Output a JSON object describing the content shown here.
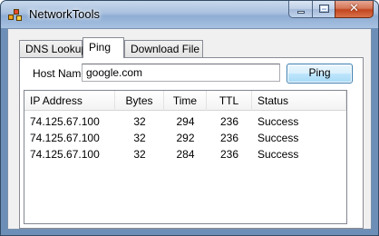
{
  "window": {
    "title": "NetworkTools"
  },
  "tabs": [
    {
      "label": "DNS Lookup",
      "active": false
    },
    {
      "label": "Ping",
      "active": true
    },
    {
      "label": "Download File",
      "active": false
    }
  ],
  "ping": {
    "host_label": "Host Name:",
    "host_value": "google.com",
    "ping_button": "Ping"
  },
  "results": {
    "columns": [
      "IP Address",
      "Bytes",
      "Time",
      "TTL",
      "Status"
    ],
    "rows": [
      {
        "ip": "74.125.67.100",
        "bytes": "32",
        "time": "294",
        "ttl": "236",
        "status": "Success"
      },
      {
        "ip": "74.125.67.100",
        "bytes": "32",
        "time": "292",
        "ttl": "236",
        "status": "Success"
      },
      {
        "ip": "74.125.67.100",
        "bytes": "32",
        "time": "284",
        "ttl": "236",
        "status": "Success"
      }
    ]
  },
  "colors": {
    "frame": "#6d8fb7",
    "client_bg": "#f0f0f0",
    "button_accent": "#3c7fb1",
    "close_button": "#c2461f"
  },
  "icons": {
    "app": "app-icon",
    "minimize": "minimize-icon",
    "maximize": "maximize-icon",
    "close": "close-icon"
  }
}
